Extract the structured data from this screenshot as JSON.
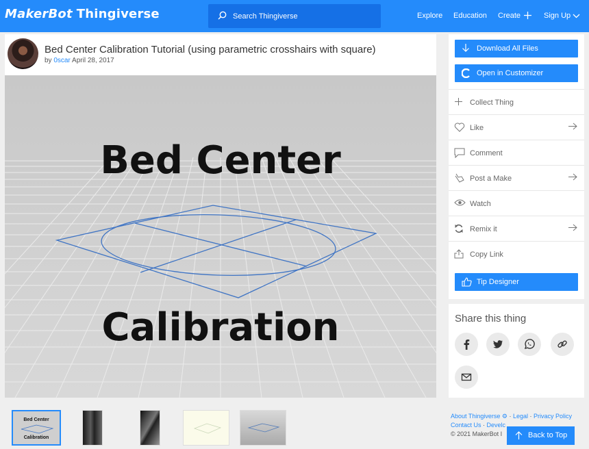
{
  "header": {
    "logo_makerbot": "MakerBot",
    "logo_thingiverse": "Thingiverse",
    "search_placeholder": "Search Thingiverse",
    "nav": [
      "Explore",
      "Education",
      "Create",
      "Sign Up"
    ]
  },
  "thing": {
    "title": "Bed Center Calibration Tutorial (using parametric crosshairs with square)",
    "by": "by",
    "author": "0scar",
    "date": "April 28, 2017",
    "image_line1": "Bed Center",
    "image_line2": "Calibration",
    "thumb_line1": "Bed Center",
    "thumb_line2": "Calibration"
  },
  "sidebar": {
    "download": "Download All Files",
    "customizer": "Open in Customizer",
    "actions": [
      {
        "label": "Collect Thing",
        "icon": "plus-icon"
      },
      {
        "label": "Like",
        "icon": "heart-icon"
      },
      {
        "label": "Comment",
        "icon": "comment-icon"
      },
      {
        "label": "Post a Make",
        "icon": "hand-icon"
      },
      {
        "label": "Watch",
        "icon": "eye-icon"
      },
      {
        "label": "Remix it",
        "icon": "remix-icon"
      },
      {
        "label": "Copy Link",
        "icon": "share-icon"
      }
    ],
    "tip": "Tip Designer"
  },
  "share": {
    "title": "Share this thing",
    "icons": [
      "facebook-icon",
      "twitter-icon",
      "whatsapp-icon",
      "link-icon",
      "email-icon"
    ]
  },
  "footer": {
    "about": "About Thingiverse",
    "legal": "Legal",
    "privacy": "Privacy Policy",
    "contact": "Contact Us",
    "developers": "Develc",
    "copyright": "© 2021 MakerBot I",
    "back_to_top": "Back to Top"
  },
  "colors": {
    "accent": "#248bfb",
    "search_bg": "#1570e6"
  }
}
